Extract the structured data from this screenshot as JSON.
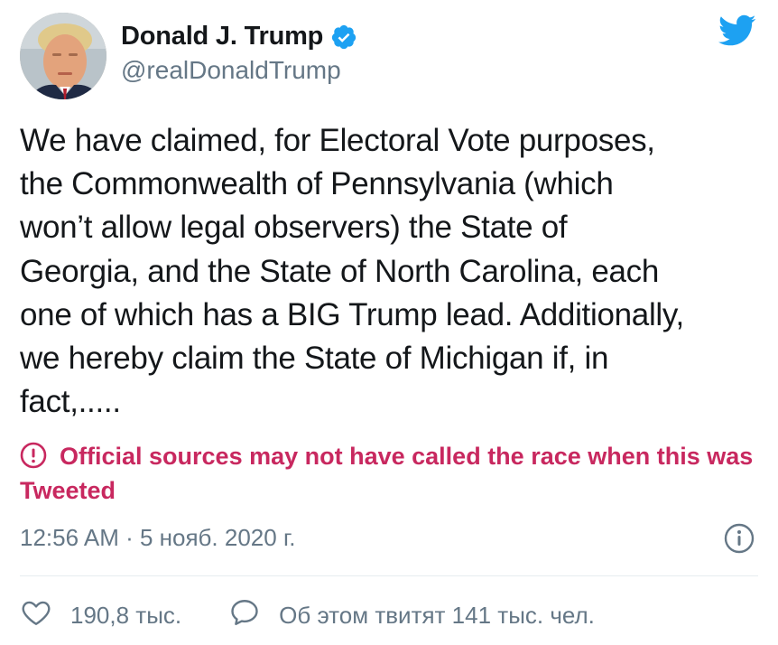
{
  "author": {
    "display_name": "Donald J. Trump",
    "handle": "@realDonaldTrump",
    "verified": true,
    "avatar_icon": "profile-photo"
  },
  "brand": {
    "icon": "twitter-bird-icon",
    "color": "#1da1f2"
  },
  "tweet": {
    "text": "We have claimed, for Electoral Vote purposes,\nthe Commonwealth of Pennsylvania (which\nwon’t allow legal observers) the State of\nGeorgia, and the State of North Carolina, each\none of which has a BIG Trump lead. Additionally,\nwe hereby claim the State of Michigan if, in\nfact,.....",
    "notice": "Official sources may not have called the race when this was Tweeted",
    "notice_color": "#c8285f",
    "notice_icon": "exclamation-circle-icon",
    "timestamp": "12:56 AM · 5 нояб. 2020 г."
  },
  "actions": {
    "like_count": "190,8 тыс.",
    "like_icon": "heart-icon",
    "reply_label": "Об этом твитят 141 тыс. чел.",
    "reply_icon": "speech-bubble-icon",
    "info_icon": "info-icon"
  }
}
